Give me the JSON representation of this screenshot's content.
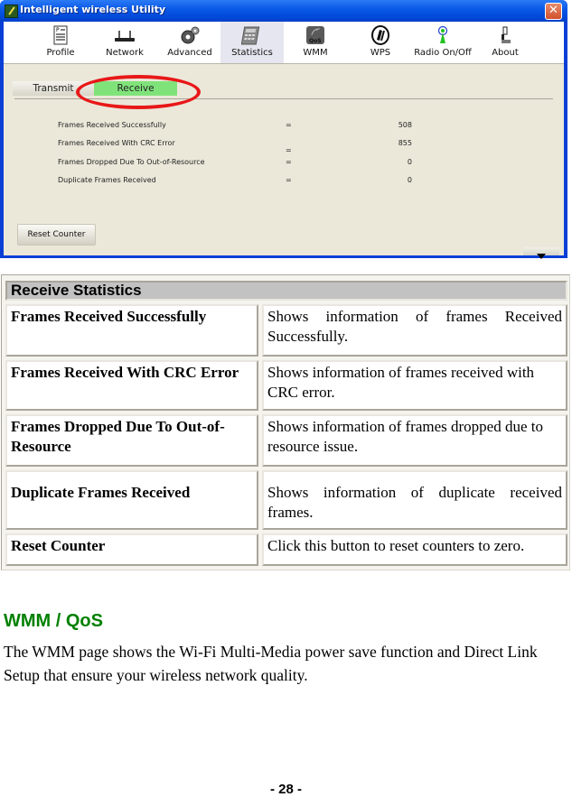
{
  "window": {
    "title": "Intelligent wireless Utility",
    "close_icon": "close-icon",
    "toolbar": [
      {
        "label": "Profile",
        "icon": "profile-icon"
      },
      {
        "label": "Network",
        "icon": "network-router-icon"
      },
      {
        "label": "Advanced",
        "icon": "gears-icon"
      },
      {
        "label": "Statistics",
        "icon": "calculator-icon",
        "active": true
      },
      {
        "label": "WMM",
        "icon": "qos-icon"
      },
      {
        "label": "WPS",
        "icon": "wps-icon"
      },
      {
        "label": "Radio On/Off",
        "icon": "radio-antenna-icon"
      },
      {
        "label": "About",
        "icon": "about-icon"
      }
    ],
    "tabs": [
      {
        "label": "Transmit",
        "active": false
      },
      {
        "label": "Receive",
        "active": true
      }
    ],
    "highlight_color": "#e81818",
    "active_tab_color": "#80e37a",
    "stats": [
      {
        "label": "Frames Received Successfully",
        "eq": "=",
        "value": "508"
      },
      {
        "label": "Frames Received With CRC Error",
        "eq": "=",
        "value": "855"
      },
      {
        "label": "Frames Dropped Due To Out-of-Resource",
        "eq": "=",
        "value": "0"
      },
      {
        "label": "Duplicate Frames Received",
        "eq": "=",
        "value": "0"
      }
    ],
    "reset_button": "Reset Counter",
    "scroll_icon": "scroll-down-icon"
  },
  "table": {
    "header": "Receive Statistics",
    "rows": [
      {
        "term": "Frames Received Successfully",
        "description": "Shows information of frames Received Successfully."
      },
      {
        "term": "Frames Received With CRC Error",
        "description": "Shows information of frames received with CRC error."
      },
      {
        "term": "Frames Dropped Due To Out-of-Resource",
        "description": "Shows information of frames dropped due to resource issue."
      },
      {
        "term": "Duplicate Frames Received",
        "description": "Shows information of duplicate received frames."
      },
      {
        "term": "Reset Counter",
        "description": "Click this button to reset counters to zero."
      }
    ]
  },
  "section": {
    "title": "WMM / QoS",
    "title_color": "#008000",
    "paragraph": "The WMM page shows the Wi-Fi Multi-Media power save function and Direct Link Setup that ensure your wireless network quality."
  },
  "page_number": "- 28 -"
}
